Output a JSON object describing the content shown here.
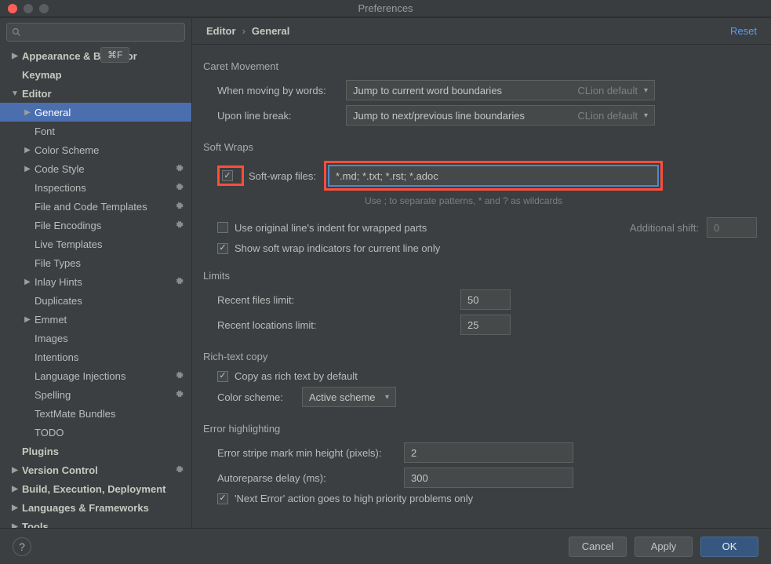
{
  "window": {
    "title": "Preferences"
  },
  "tooltip": "⌘F",
  "breadcrumb": {
    "a": "Editor",
    "b": "General",
    "reset": "Reset"
  },
  "sidebar": {
    "items": [
      {
        "label": "Appearance & Behavior",
        "depth": 0,
        "bold": true,
        "arrow": "▶"
      },
      {
        "label": "Keymap",
        "depth": 0,
        "bold": true
      },
      {
        "label": "Editor",
        "depth": 0,
        "bold": true,
        "arrow": "▼"
      },
      {
        "label": "General",
        "depth": 1,
        "arrow": "▶",
        "selected": true
      },
      {
        "label": "Font",
        "depth": 1
      },
      {
        "label": "Color Scheme",
        "depth": 1,
        "arrow": "▶"
      },
      {
        "label": "Code Style",
        "depth": 1,
        "arrow": "▶",
        "gear": true
      },
      {
        "label": "Inspections",
        "depth": 1,
        "gear": true
      },
      {
        "label": "File and Code Templates",
        "depth": 1,
        "gear": true
      },
      {
        "label": "File Encodings",
        "depth": 1,
        "gear": true
      },
      {
        "label": "Live Templates",
        "depth": 1
      },
      {
        "label": "File Types",
        "depth": 1
      },
      {
        "label": "Inlay Hints",
        "depth": 1,
        "arrow": "▶",
        "gear": true
      },
      {
        "label": "Duplicates",
        "depth": 1
      },
      {
        "label": "Emmet",
        "depth": 1,
        "arrow": "▶"
      },
      {
        "label": "Images",
        "depth": 1
      },
      {
        "label": "Intentions",
        "depth": 1
      },
      {
        "label": "Language Injections",
        "depth": 1,
        "gear": true
      },
      {
        "label": "Spelling",
        "depth": 1,
        "gear": true
      },
      {
        "label": "TextMate Bundles",
        "depth": 1
      },
      {
        "label": "TODO",
        "depth": 1
      },
      {
        "label": "Plugins",
        "depth": 0,
        "bold": true
      },
      {
        "label": "Version Control",
        "depth": 0,
        "bold": true,
        "arrow": "▶",
        "gear": true
      },
      {
        "label": "Build, Execution, Deployment",
        "depth": 0,
        "bold": true,
        "arrow": "▶"
      },
      {
        "label": "Languages & Frameworks",
        "depth": 0,
        "bold": true,
        "arrow": "▶"
      },
      {
        "label": "Tools",
        "depth": 0,
        "bold": true,
        "arrow": "▶"
      }
    ]
  },
  "sections": {
    "caret": {
      "title": "Caret Movement",
      "wordsLabel": "When moving by words:",
      "wordsValue": "Jump to current word boundaries",
      "wordsDefault": "CLion default",
      "breakLabel": "Upon line break:",
      "breakValue": "Jump to next/previous line boundaries",
      "breakDefault": "CLion default"
    },
    "wraps": {
      "title": "Soft Wraps",
      "cbFilesLabel": "Soft-wrap files:",
      "filesValue": "*.md; *.txt; *.rst; *.adoc",
      "hint": "Use ; to separate patterns, * and ? as wildcards",
      "cbIndent": "Use original line's indent for wrapped parts",
      "addlShift": "Additional shift:",
      "addlShiftVal": "0",
      "cbIndicators": "Show soft wrap indicators for current line only"
    },
    "limits": {
      "title": "Limits",
      "recentFiles": "Recent files limit:",
      "recentFilesVal": "50",
      "recentLoc": "Recent locations limit:",
      "recentLocVal": "25"
    },
    "rich": {
      "title": "Rich-text copy",
      "cbCopy": "Copy as rich text by default",
      "schemeLabel": "Color scheme:",
      "schemeValue": "Active scheme"
    },
    "error": {
      "title": "Error highlighting",
      "stripeLabel": "Error stripe mark min height (pixels):",
      "stripeVal": "2",
      "reparseLabel": "Autoreparse delay (ms):",
      "reparseVal": "300",
      "cbNext": "'Next Error' action goes to high priority problems only"
    }
  },
  "footer": {
    "cancel": "Cancel",
    "apply": "Apply",
    "ok": "OK"
  }
}
